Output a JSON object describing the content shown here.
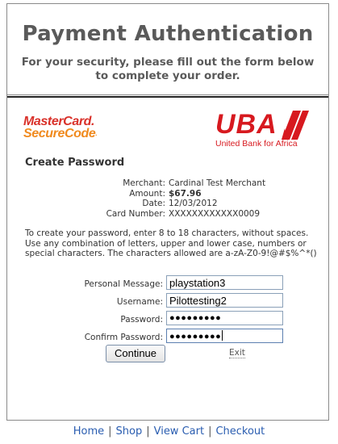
{
  "header": {
    "title": "Payment Authentication",
    "subtitle": "For your security, please fill out the form below to complete your order."
  },
  "brand": {
    "mastercard_line1": "MasterCard.",
    "mastercard_line2": "SecureCode",
    "mastercard_tm": ".",
    "bank_name": "UBA",
    "bank_tagline": "United Bank for Africa",
    "colors": {
      "mastercard_red": "#d9312a",
      "mastercard_orange": "#f08a1e",
      "uba_red": "#d7191f"
    }
  },
  "section_title": "Create Password",
  "details": [
    {
      "label": "Merchant:",
      "value": "Cardinal Test Merchant",
      "bold": false
    },
    {
      "label": "Amount:",
      "value": "$67.96",
      "bold": true
    },
    {
      "label": "Date:",
      "value": "12/03/2012",
      "bold": false
    },
    {
      "label": "Card Number:",
      "value": "XXXXXXXXXXXX0009",
      "bold": false
    }
  ],
  "instructions": "To create your password, enter 8 to 18 characters, without spaces. Use any combination of letters, upper and lower case, numbers or special characters. The characters allowed are a-zA-Z0-9!@#$%^*()",
  "form": {
    "personal_message_label": "Personal Message:",
    "personal_message_value": "playstation3",
    "username_label": "Username:",
    "username_value": "Pilottesting2",
    "password_label": "Password:",
    "password_value": "●●●●●●●●●",
    "confirm_label": "Confirm Password:",
    "confirm_value": "●●●●●●●●●"
  },
  "buttons": {
    "continue": "Continue",
    "exit": "Exit"
  },
  "footer": {
    "home": "Home",
    "shop": "Shop",
    "view_cart": "View Cart",
    "checkout": "Checkout",
    "separator": "|"
  }
}
